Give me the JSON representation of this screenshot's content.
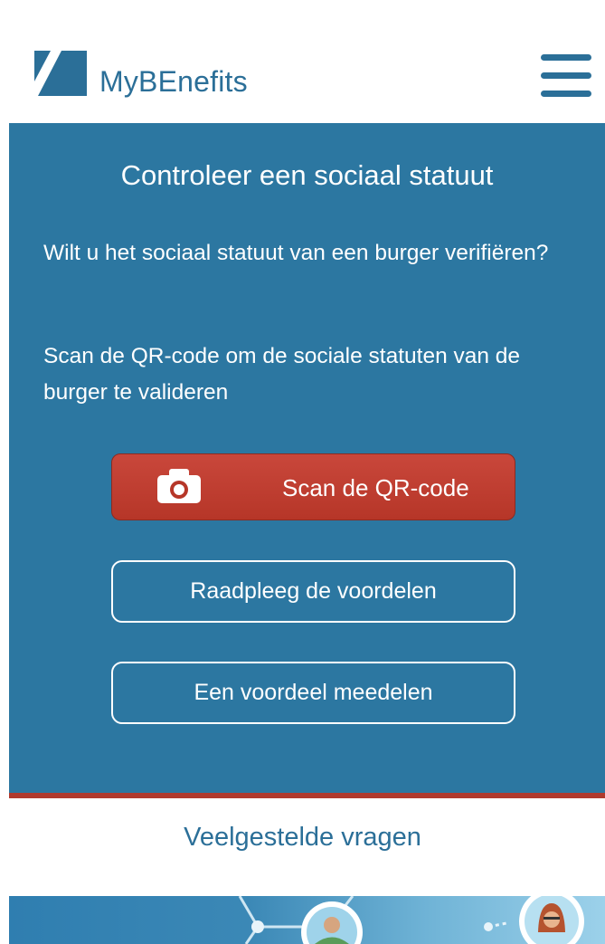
{
  "header": {
    "logo_text": "MyBEnefits",
    "menu_icon": "hamburger-menu-icon"
  },
  "panel": {
    "title": "Controleer een sociaal statuut",
    "paragraph1": "Wilt u het sociaal statuut van een burger verifiëren?",
    "paragraph2": "Scan de QR-code om de sociale statuten van de burger te valideren",
    "scan_button": {
      "label": "Scan de QR-code",
      "icon": "camera-icon"
    },
    "consult_button": "Raadpleeg de voordelen",
    "share_button": "Een voordeel meedelen"
  },
  "faq_link": "Veelgestelde vragen",
  "colors": {
    "brand_blue": "#2b6f98",
    "panel_blue": "#2c77a1",
    "scan_red": "#b63628",
    "divider_red": "#b03a2e"
  }
}
